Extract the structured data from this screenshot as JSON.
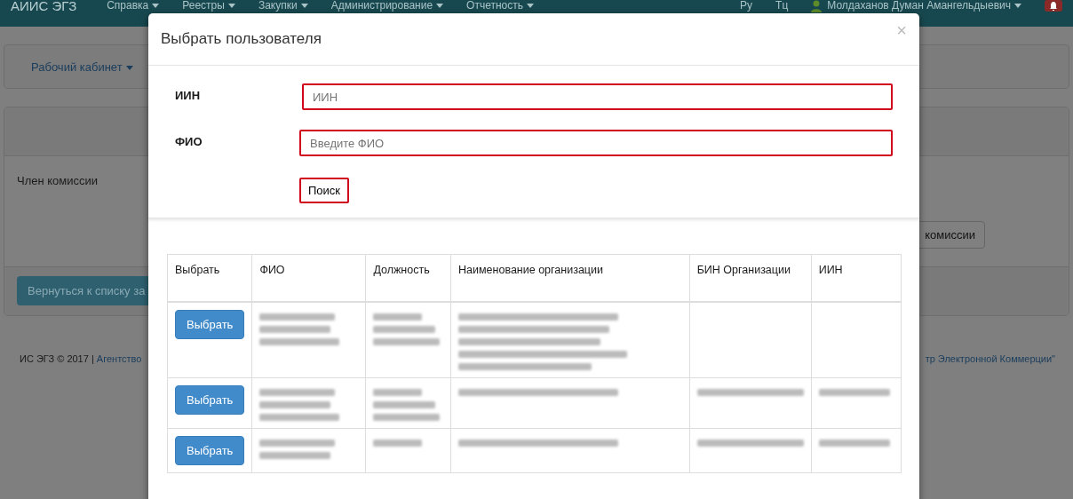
{
  "navbar": {
    "brand": "АИИС ЭГЗ",
    "menus": [
      "Справка",
      "Реестры",
      "Закупки",
      "Администрирование",
      "Отчетность"
    ],
    "languages": [
      "Ру",
      "Тц"
    ],
    "user": "Молдаханов Думан Амангельдыевич"
  },
  "page": {
    "cabinet_menu": "Рабочий кабинет",
    "role": "Член комиссии",
    "commission_button": "комиссии",
    "back_button": "Вернуться к списку за",
    "footer_text": "ИС ЭГЗ © 2017 | ",
    "footer_link": "Агентство",
    "footer_right": "тр Электронной Коммерции\""
  },
  "modal": {
    "title": "Выбрать пользователя",
    "close": "×",
    "fields": [
      {
        "label": "ИИН",
        "placeholder": "ИИН",
        "highlighted": true
      },
      {
        "label": "ФИО",
        "placeholder": "Введите ФИО",
        "highlighted": true
      }
    ],
    "search_button": {
      "label": "Поиск",
      "highlighted": true
    },
    "table": {
      "columns": [
        "Выбрать",
        "ФИО",
        "Должность",
        "Наименование организации",
        "БИН Организации",
        "ИИН"
      ],
      "rows": [
        {
          "button": "Выбрать",
          "cells": [
            {
              "kind": "blurred_block"
            },
            {
              "kind": "blurred_block"
            },
            {
              "kind": "blurred_block"
            },
            {
              "kind": "empty"
            },
            {
              "kind": "empty"
            }
          ]
        },
        {
          "button": "Выбрать",
          "cells": [
            {
              "kind": "blurred_block"
            },
            {
              "kind": "blurred_block"
            },
            {
              "kind": "blurred_line"
            },
            {
              "kind": "blurred_line"
            },
            {
              "kind": "blurred_line"
            }
          ]
        },
        {
          "button": "Выбрать",
          "cells": [
            {
              "kind": "blurred_pair"
            },
            {
              "kind": "blurred_line"
            },
            {
              "kind": "blurred_line"
            },
            {
              "kind": "blurred_line"
            },
            {
              "kind": "blurred_line"
            }
          ]
        }
      ]
    }
  }
}
